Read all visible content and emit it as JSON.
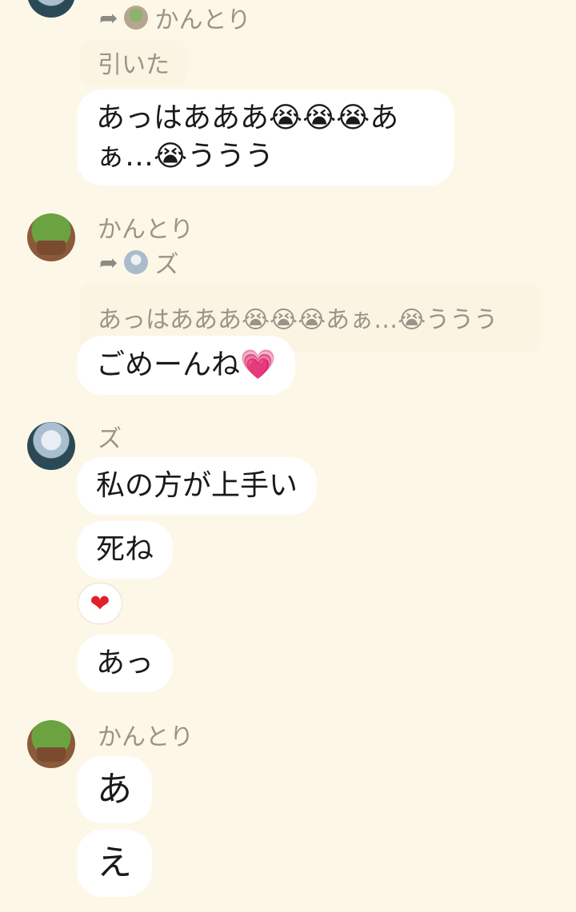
{
  "messages": {
    "m1": {
      "reply_to_name": "かんとり",
      "quote": "引いた",
      "bubble_line1": "あっはあああ😭😭😭あ",
      "bubble_line2": "ぁ…😭ううう"
    },
    "m2": {
      "sender": "かんとり",
      "reply_to_name": "ズ",
      "quote": "あっはあああ😭😭😭あぁ…😭ううう",
      "bubble": "ごめーんね💗"
    },
    "m3": {
      "sender": "ズ",
      "bubble1": "私の方が上手い",
      "bubble2": "死ね",
      "reaction": "❤",
      "bubble3": "あっ"
    },
    "m4": {
      "sender": "かんとり",
      "bubble1": "あ",
      "bubble2": "え"
    }
  },
  "icons": {
    "reply": "reply-arrow-icon",
    "heart": "heart-icon"
  }
}
